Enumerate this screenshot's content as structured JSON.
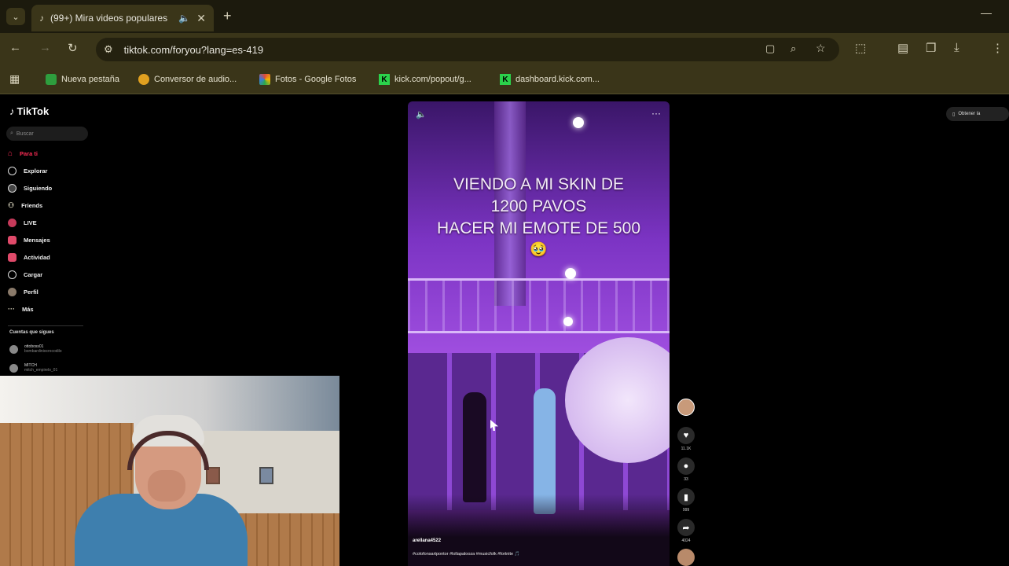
{
  "browser": {
    "tab_title": "(99+) Mira videos populares",
    "url": "tiktok.com/foryou?lang=es-419",
    "bookmarks": [
      {
        "label": "Nueva pestaña",
        "color": "#2e9e3e"
      },
      {
        "label": "Conversor de audio...",
        "color": "#e0a020"
      },
      {
        "label": "Fotos - Google Fotos",
        "color": "#e04a3a"
      },
      {
        "label": "kick.com/popout/g...",
        "color": "#2bd14b"
      },
      {
        "label": "dashboard.kick.com...",
        "color": "#2bd14b"
      }
    ]
  },
  "tiktok": {
    "logo": "TikTok",
    "search_placeholder": "Buscar",
    "nav": [
      {
        "label": "Para ti",
        "color": "#fe2c55"
      },
      {
        "label": "Explorar"
      },
      {
        "label": "Siguiendo"
      },
      {
        "label": "Friends"
      },
      {
        "label": "LIVE"
      },
      {
        "label": "Mensajes"
      },
      {
        "label": "Actividad"
      },
      {
        "label": "Cargar"
      },
      {
        "label": "Perfil"
      },
      {
        "label": "Más"
      }
    ],
    "following_title": "Cuentas que sigues",
    "following": [
      {
        "name": "ottoboss01",
        "handle": "bombardiniocrocodilo"
      },
      {
        "name": "MITCH",
        "handle": "mitch_empirelo_01"
      }
    ],
    "top_right": "Obtener la"
  },
  "video": {
    "caption_lines": [
      "VIENDO A MI SKIN DE",
      "1200 PAVOS",
      "HACER MI EMOTE DE 500"
    ],
    "emoji": "🥹",
    "author": "arellana4522",
    "description": "#colofonsartpontor #lollapalooza #musicfolk #fortnite 🎵",
    "counts": {
      "likes": "11.1K",
      "comments": "33",
      "saves": "999",
      "shares": "4024"
    }
  }
}
